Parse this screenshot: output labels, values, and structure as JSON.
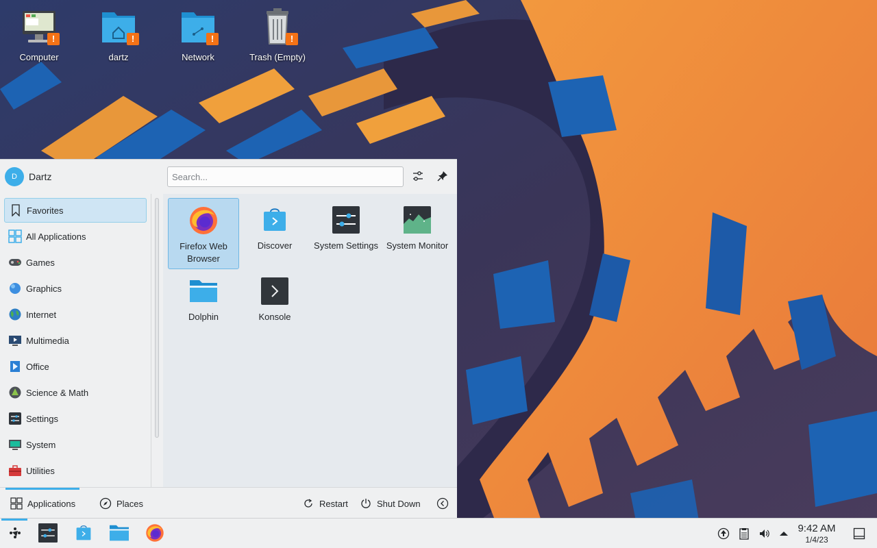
{
  "desktop": {
    "icons": [
      {
        "label": "Computer",
        "icon": "computer-icon"
      },
      {
        "label": "dartz",
        "icon": "home-folder-icon"
      },
      {
        "label": "Network",
        "icon": "network-folder-icon"
      },
      {
        "label": "Trash (Empty)",
        "icon": "trash-icon"
      }
    ],
    "warning_badge": "!"
  },
  "launcher": {
    "user": {
      "avatar_letter": "D",
      "name": "Dartz"
    },
    "search": {
      "placeholder": "Search..."
    },
    "categories": [
      {
        "label": "Favorites",
        "icon": "bookmark-icon",
        "active": true
      },
      {
        "label": "All Applications",
        "icon": "grid-icon"
      },
      {
        "label": "Games",
        "icon": "gamepad-icon"
      },
      {
        "label": "Graphics",
        "icon": "graphics-icon"
      },
      {
        "label": "Internet",
        "icon": "globe-icon"
      },
      {
        "label": "Multimedia",
        "icon": "multimedia-icon"
      },
      {
        "label": "Office",
        "icon": "office-icon"
      },
      {
        "label": "Science & Math",
        "icon": "science-icon"
      },
      {
        "label": "Settings",
        "icon": "settings-sliders-icon"
      },
      {
        "label": "System",
        "icon": "system-icon"
      },
      {
        "label": "Utilities",
        "icon": "toolbox-icon"
      }
    ],
    "favorites": [
      {
        "label": "Firefox Web Browser",
        "icon": "firefox-icon",
        "selected": true
      },
      {
        "label": "Discover",
        "icon": "discover-icon"
      },
      {
        "label": "System Settings",
        "icon": "system-settings-icon"
      },
      {
        "label": "System Monitor",
        "icon": "system-monitor-icon"
      },
      {
        "label": "Dolphin",
        "icon": "dolphin-icon"
      },
      {
        "label": "Konsole",
        "icon": "konsole-icon"
      }
    ],
    "footer": {
      "applications": "Applications",
      "places": "Places",
      "restart": "Restart",
      "shutdown": "Shut Down"
    }
  },
  "taskbar": {
    "apps": [
      "application-launcher-icon",
      "system-settings-icon",
      "discover-icon",
      "dolphin-icon",
      "firefox-icon"
    ],
    "clock": {
      "time": "9:42 AM",
      "date": "1/4/23"
    }
  },
  "colors": {
    "accent": "#3daee9",
    "warning": "#f47216",
    "wallpaper_orange": "#f0873a",
    "wallpaper_blue": "#1d63b3",
    "wallpaper_dark": "#2f2c4e"
  }
}
